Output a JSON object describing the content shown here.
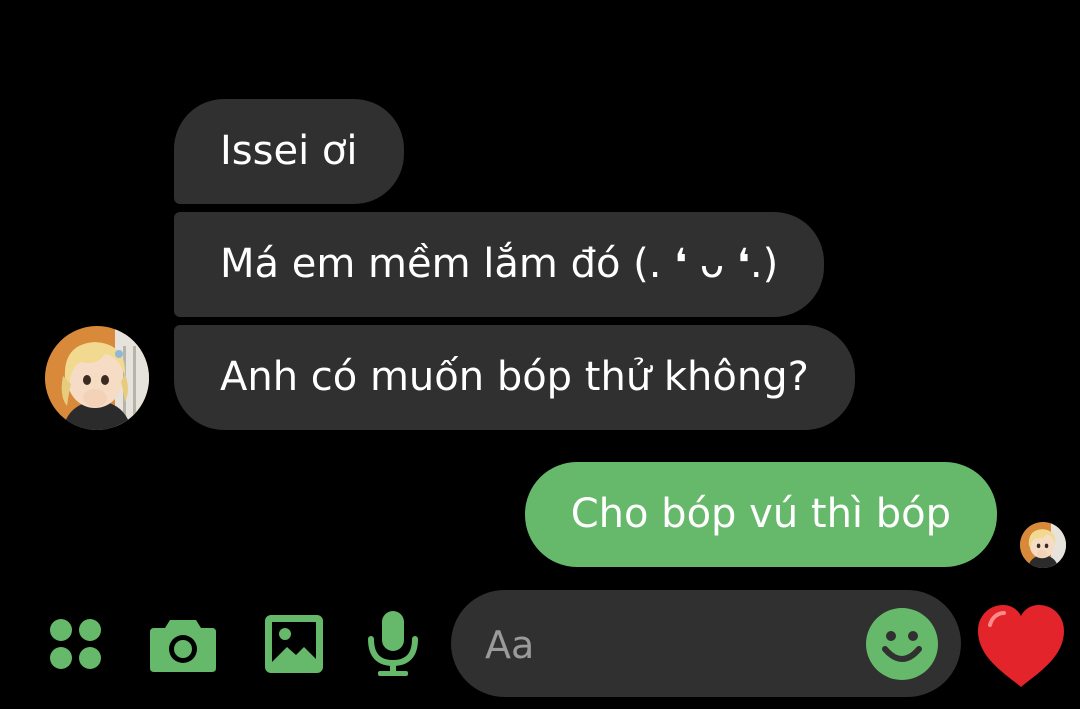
{
  "conversation": {
    "incoming": [
      {
        "text": "Issei ơi"
      },
      {
        "text": "Má em mềm lắm đó (. ❛ ᴗ ❛.)"
      },
      {
        "text": "Anh có muốn bóp thử không?"
      }
    ],
    "outgoing": [
      {
        "text": "Cho bóp vú thì bóp"
      }
    ]
  },
  "composer": {
    "placeholder": "Aa",
    "value": ""
  },
  "toolbar": {
    "icons": [
      "apps-icon",
      "camera-icon",
      "gallery-icon",
      "microphone-icon"
    ],
    "emoji_icon": "smiley-icon",
    "like_icon": "heart-icon"
  },
  "colors": {
    "background": "#000000",
    "incoming_bubble": "#303030",
    "outgoing_bubble": "#66b96a",
    "accent": "#66b96a",
    "like": "#e3242b"
  }
}
